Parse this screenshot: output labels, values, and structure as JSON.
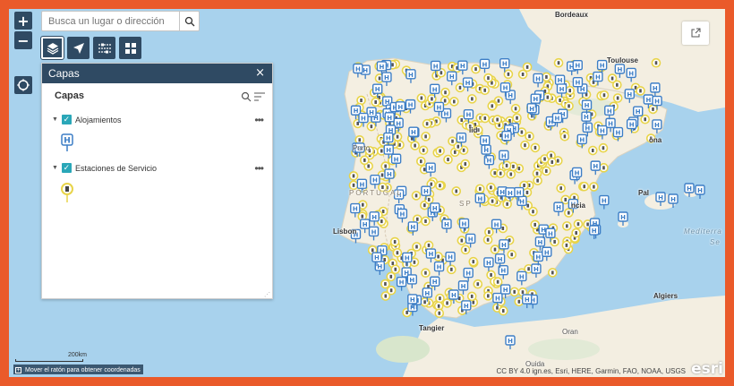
{
  "search": {
    "placeholder": "Busca un lugar o dirección"
  },
  "zoom": {
    "in_label": "+",
    "out_label": "−"
  },
  "panel": {
    "title": "Capas",
    "close_label": "×",
    "subtitle": "Capas",
    "layers": [
      {
        "name": "Alojamientos",
        "visible": true,
        "symbol": "hotel-marker-icon"
      },
      {
        "name": "Estaciones de Servicio",
        "visible": true,
        "symbol": "fuel-marker-icon"
      }
    ]
  },
  "scalebar": {
    "label": "200km"
  },
  "coordinates": {
    "text": "Mover el ratón para obtener coordenadas"
  },
  "attribution": "CC BY 4.0 ign.es, Esri, HERE, Garmin, FAO, NOAA, USGS",
  "esri_logo": "esri",
  "places": [
    {
      "name": "Bordeaux"
    },
    {
      "name": "Toulouse"
    },
    {
      "name": "Porto"
    },
    {
      "name": "PORTUGAL"
    },
    {
      "name": "Lisbon"
    },
    {
      "name": "lid"
    },
    {
      "name": "ona"
    },
    {
      "name": "Pal"
    },
    {
      "name": "SP"
    },
    {
      "name": "ncia"
    },
    {
      "name": "Mediterra"
    },
    {
      "name": "Se"
    },
    {
      "name": "Algiers"
    },
    {
      "name": "Tangier"
    },
    {
      "name": "Oran"
    },
    {
      "name": "Ouida"
    }
  ],
  "colors": {
    "frame": "#ea5a2a",
    "water": "#a8d2ed",
    "land": "#f4efe2",
    "panel_header": "#2f4a63",
    "checkbox": "#2aa7b8",
    "hotel_marker": "#3d7ec6",
    "fuel_marker": "#e8d44a"
  }
}
